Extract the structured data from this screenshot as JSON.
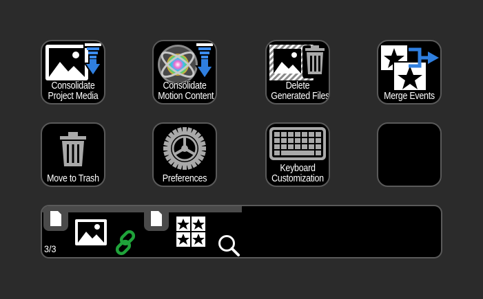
{
  "keys": [
    {
      "id": "consolidate-project-media",
      "line1": "Consolidate",
      "line2": "Project Media",
      "icon": "photo-download-icon"
    },
    {
      "id": "consolidate-motion-content",
      "line1": "Consolidate",
      "line2": "Motion Content",
      "icon": "motion-download-icon"
    },
    {
      "id": "delete-generated-files",
      "line1": "Delete",
      "line2": "Generated Files",
      "icon": "photo-trash-icon"
    },
    {
      "id": "merge-events",
      "line1": "",
      "line2": "Merge Events",
      "icon": "star-merge-icon"
    },
    {
      "id": "move-to-trash",
      "line1": "",
      "line2": "Move to Trash",
      "icon": "trash-icon"
    },
    {
      "id": "preferences",
      "line1": "",
      "line2": "Preferences",
      "icon": "gear-icon"
    },
    {
      "id": "keyboard-customization",
      "line1": "Keyboard",
      "line2": "Customization",
      "icon": "keyboard-icon"
    },
    {
      "id": "empty-key",
      "line1": "",
      "line2": "",
      "icon": ""
    }
  ],
  "strip": {
    "page_indicator": "3/3",
    "icons": [
      "document-icon",
      "photo-icon",
      "link-icon",
      "document-icon",
      "stars-grid-icon",
      "magnifier-icon"
    ]
  },
  "colors": {
    "background": "#2b2b2b",
    "key_border": "#5a5a5a",
    "accent_blue": "#2f7fe0",
    "link_green": "#1fa33a"
  }
}
